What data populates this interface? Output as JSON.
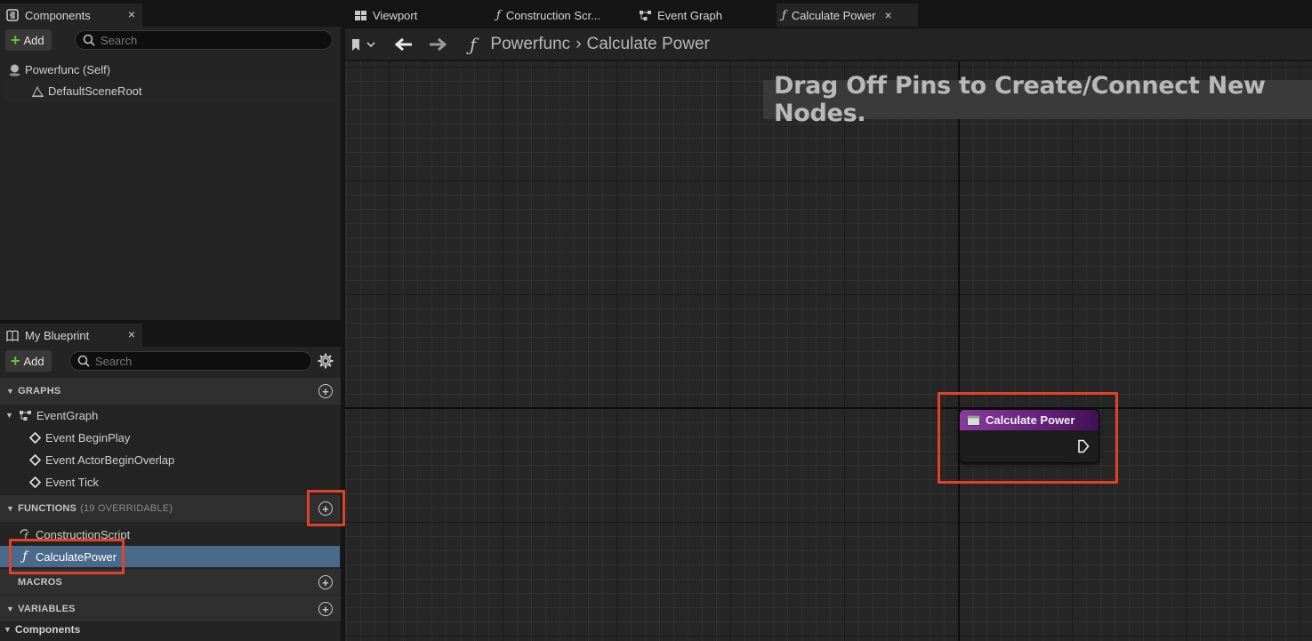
{
  "components_panel": {
    "tab_label": "Components",
    "close": "×",
    "add_label": "Add",
    "search_placeholder": "Search",
    "tree": [
      {
        "label": "Powerfunc (Self)"
      },
      {
        "label": "DefaultSceneRoot"
      }
    ]
  },
  "my_blueprint_panel": {
    "tab_label": "My Blueprint",
    "close": "×",
    "add_label": "Add",
    "search_placeholder": "Search",
    "sections": {
      "graphs": {
        "label": "GRAPHS"
      },
      "functions": {
        "label": "FUNCTIONS",
        "sub": "(19 OVERRIDABLE)"
      },
      "macros": {
        "label": "MACROS"
      },
      "variables": {
        "label": "VARIABLES"
      }
    },
    "graph_items": [
      {
        "label": "EventGraph"
      },
      {
        "label": "Event BeginPlay"
      },
      {
        "label": "Event ActorBeginOverlap"
      },
      {
        "label": "Event Tick"
      }
    ],
    "function_items": [
      {
        "label": "ConstructionScript"
      },
      {
        "label": "CalculatePower"
      }
    ],
    "components_category": "Components"
  },
  "document_tabs": [
    {
      "label": "Viewport"
    },
    {
      "label": "Construction Scr..."
    },
    {
      "label": "Event Graph"
    },
    {
      "label": "Calculate Power",
      "active": true,
      "close": "×"
    }
  ],
  "breadcrumb": {
    "root": "Powerfunc",
    "separator": "›",
    "current": "Calculate Power"
  },
  "graph": {
    "hint": "Drag Off Pins to Create/Connect New Nodes.",
    "node_title": "Calculate Power"
  },
  "colors": {
    "highlight": "#e0432a",
    "selected_row": "#4a6a8c",
    "add_plus": "#63c23a",
    "function_node_header": "#8a3aa0"
  }
}
